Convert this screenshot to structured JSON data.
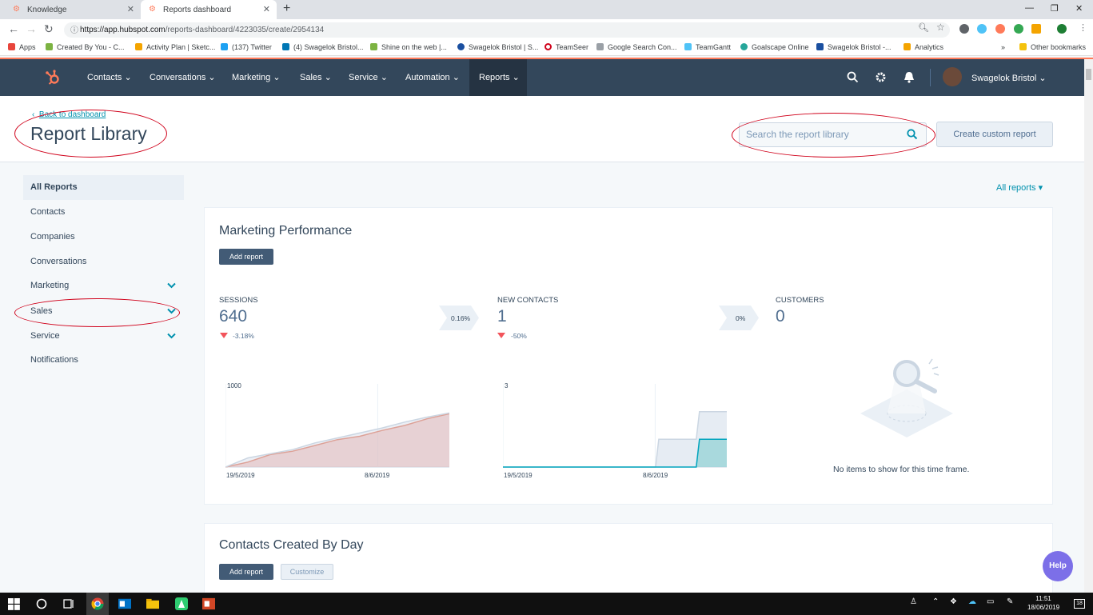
{
  "browser": {
    "tabs": [
      {
        "title": "Knowledge"
      },
      {
        "title": "Reports dashboard"
      }
    ],
    "url_host": "https://app.hubspot.com",
    "url_path": "/reports-dashboard/4223035/create/2954134",
    "bookmarks": [
      "Apps",
      "Created By You - C...",
      "Activity Plan | Sketc...",
      "(137) Twitter",
      "(4) Swagelok Bristol...",
      "Shine on the web |...",
      "Swagelok Bristol | S...",
      "TeamSeer",
      "Google Search Con...",
      "TeamGantt",
      "Goalscape Online",
      "Swagelok Bristol -...",
      "Analytics",
      "Other bookmarks"
    ],
    "bookmarks_overflow": "»"
  },
  "nav": {
    "items": [
      "Contacts",
      "Conversations",
      "Marketing",
      "Sales",
      "Service",
      "Automation",
      "Reports"
    ],
    "user_name": "Swagelok Bristol"
  },
  "header": {
    "back_link": "Back to dashboard",
    "title": "Report Library",
    "search_placeholder": "Search the report library",
    "create_button": "Create custom report"
  },
  "sidebar": {
    "items": [
      "All Reports",
      "Contacts",
      "Companies",
      "Conversations",
      "Marketing",
      "Sales",
      "Service",
      "Notifications"
    ]
  },
  "filter": {
    "label": "All reports"
  },
  "card1": {
    "title": "Marketing Performance",
    "add_button": "Add report",
    "kpis": [
      {
        "label": "SESSIONS",
        "value": "640",
        "change": "-3.18%"
      },
      {
        "label": "NEW CONTACTS",
        "value": "1",
        "change": "-50%"
      },
      {
        "label": "CUSTOMERS",
        "value": "0"
      }
    ],
    "conversions": [
      "0.16%",
      "0%"
    ],
    "empty_text": "No items to show for this time frame."
  },
  "chart_data": [
    {
      "type": "area",
      "title": "SESSIONS",
      "x": [
        "19/5/2019",
        "8/6/2019"
      ],
      "y_tick": "1000",
      "series": [
        {
          "values": [
            0,
            60,
            150,
            190,
            260,
            330,
            370,
            440,
            500,
            580,
            640
          ]
        },
        {
          "values": [
            0,
            110,
            160,
            210,
            290,
            350,
            410,
            470,
            540,
            600,
            650
          ]
        }
      ],
      "ylim": [
        0,
        1000
      ]
    },
    {
      "type": "area",
      "title": "NEW CONTACTS",
      "x": [
        "19/5/2019",
        "8/6/2019"
      ],
      "y_tick": "3",
      "series": [
        {
          "values": [
            0,
            0,
            0,
            0,
            0,
            0,
            0,
            0,
            1,
            1,
            2,
            2
          ]
        },
        {
          "values": [
            0,
            0,
            0,
            0,
            0,
            0,
            0,
            0,
            0,
            0,
            1,
            1
          ]
        }
      ],
      "ylim": [
        0,
        3
      ]
    }
  ],
  "card2": {
    "title": "Contacts Created By Day",
    "add_button": "Add report",
    "customize_button": "Customize"
  },
  "help": {
    "label": "Help"
  },
  "taskbar": {
    "time": "11:51",
    "date": "18/06/2019",
    "badge": "18"
  },
  "colors": {
    "accent": "#ff7a59",
    "nav": "#33475b",
    "link": "#0091ae",
    "annotation": "#d0021b"
  }
}
